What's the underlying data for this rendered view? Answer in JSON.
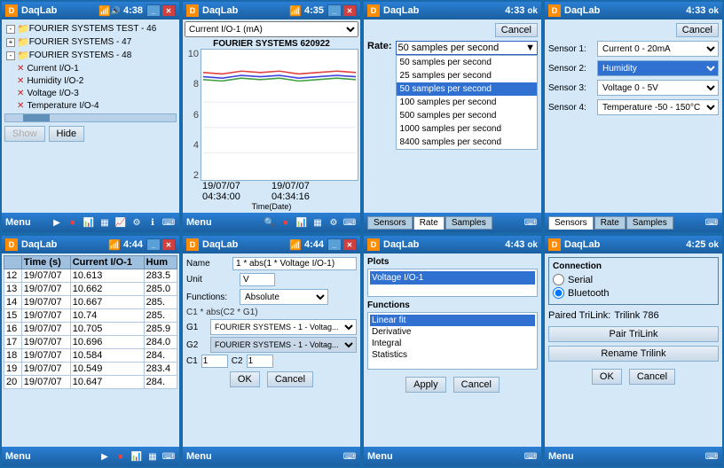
{
  "panels": {
    "p1": {
      "title": "DaqLab",
      "time": "4:38",
      "tree": {
        "items": [
          {
            "label": "FOURIER SYSTEMS TEST - 46",
            "level": 0,
            "type": "folder",
            "expanded": true
          },
          {
            "label": "FOURIER SYSTEMS - 47",
            "level": 0,
            "type": "folder",
            "expanded": false
          },
          {
            "label": "FOURIER SYSTEMS - 48",
            "level": 0,
            "type": "folder",
            "expanded": true
          },
          {
            "label": "Current I/O-1",
            "level": 1,
            "type": "sensor"
          },
          {
            "label": "Humidity I/O-2",
            "level": 1,
            "type": "sensor"
          },
          {
            "label": "Voltage I/O-3",
            "level": 1,
            "type": "sensor"
          },
          {
            "label": "Temperature I/O-4",
            "level": 1,
            "type": "sensor"
          }
        ]
      },
      "buttons": {
        "show": "Show",
        "hide": "Hide"
      },
      "menu": "Menu"
    },
    "p2": {
      "title": "DaqLab",
      "time": "4:35",
      "dropdown_value": "Current I/O-1 (mA)",
      "chart_title": "FOURIER SYSTEMS    620922",
      "x_label": "Time(Date)",
      "x_start": "19/07/07 04:34:00",
      "x_end": "19/07/07 04:34:16",
      "y_values": [
        "10",
        "8",
        "6",
        "4",
        "2"
      ],
      "menu": "Menu"
    },
    "p3": {
      "title": "DaqLab",
      "time": "4:33",
      "rate_label": "Rate:",
      "cancel_btn": "Cancel",
      "options": [
        {
          "label": "50 samples per second",
          "selected": false
        },
        {
          "label": "25 samples per second",
          "selected": false
        },
        {
          "label": "50 samples per second",
          "selected": true
        },
        {
          "label": "100 samples per second",
          "selected": false
        },
        {
          "label": "500 samples per second",
          "selected": false
        },
        {
          "label": "1000 samples per second",
          "selected": false
        },
        {
          "label": "8400 samples per second",
          "selected": false
        }
      ],
      "tabs": [
        "Sensors",
        "Rate",
        "Samples"
      ],
      "menu": "Menu"
    },
    "p4": {
      "title": "DaqLab",
      "time": "4:33",
      "cancel_btn": "Cancel",
      "sensors": [
        {
          "label": "Sensor 1:",
          "value": "Current 0 - 20mA",
          "highlighted": false
        },
        {
          "label": "Sensor 2:",
          "value": "Humidity",
          "highlighted": true
        },
        {
          "label": "Sensor 3:",
          "value": "Voltage 0 - 5V",
          "highlighted": false
        },
        {
          "label": "Sensor 4:",
          "value": "Temperature -50 - 150°C",
          "highlighted": false
        }
      ],
      "tabs": [
        "Sensors",
        "Rate",
        "Samples"
      ],
      "menu": "Menu"
    },
    "p5": {
      "title": "DaqLab",
      "time": "4:44",
      "columns": [
        "Time (s)",
        "Current I/O-1",
        "Hum"
      ],
      "rows": [
        {
          "n": "12",
          "time": "19/07/07",
          "curr": "10.613",
          "hum": "283.5"
        },
        {
          "n": "13",
          "time": "19/07/07",
          "curr": "10.662",
          "hum": "285.0"
        },
        {
          "n": "14",
          "time": "19/07/07",
          "curr": "10.667",
          "hum": "285."
        },
        {
          "n": "15",
          "time": "19/07/07",
          "curr": "10.74",
          "hum": "285."
        },
        {
          "n": "16",
          "time": "19/07/07",
          "curr": "10.705",
          "hum": "285.9"
        },
        {
          "n": "17",
          "time": "19/07/07",
          "curr": "10.696",
          "hum": "284.0"
        },
        {
          "n": "18",
          "time": "19/07/07",
          "curr": "10.584",
          "hum": "284."
        },
        {
          "n": "19",
          "time": "19/07/07",
          "curr": "10.549",
          "hum": "283.4"
        },
        {
          "n": "20",
          "time": "19/07/07",
          "curr": "10.647",
          "hum": "284."
        }
      ],
      "menu": "Menu"
    },
    "p6": {
      "title": "DaqLab",
      "time": "4:44",
      "name_label": "Name",
      "name_value": "1 * abs(1 * Voltage I/O-1)",
      "unit_label": "Unit",
      "unit_value": "V",
      "functions_label": "Functions:",
      "functions_value": "Absolute",
      "formula": "C1 * abs(C2 * G1)",
      "g1_label": "G1",
      "g1_value": "FOURIER SYSTEMS - 1 - Voltag...",
      "g2_label": "G2",
      "g2_value": "FOURIER SYSTEMS - 1 - Voltag...",
      "c1_label": "C1",
      "c1_value": "1",
      "c2_label": "C2",
      "c2_value": "1",
      "ok_btn": "OK",
      "cancel_btn": "Cancel",
      "menu": "Menu"
    },
    "p7": {
      "title": "DaqLab",
      "time": "4:43",
      "plots_label": "Plots",
      "plots_items": [
        {
          "label": "Voltage I/O-1",
          "selected": true
        }
      ],
      "functions_label": "Functions",
      "functions_items": [
        {
          "label": "Linear fit",
          "selected": true
        },
        {
          "label": "Derivative",
          "selected": false
        },
        {
          "label": "Integral",
          "selected": false
        },
        {
          "label": "Statistics",
          "selected": false
        }
      ],
      "apply_btn": "Apply",
      "cancel_btn": "Cancel",
      "menu": "Menu"
    },
    "p8": {
      "title": "DaqLab",
      "time": "4:25",
      "connection_title": "Connection",
      "serial_label": "Serial",
      "bluetooth_label": "Bluetooth",
      "bluetooth_selected": true,
      "paired_label": "Paired TriLink:",
      "paired_value": "Trilink 786",
      "pair_btn": "Pair TriLink",
      "rename_btn": "Rename Trilink",
      "ok_btn": "OK",
      "cancel_btn": "Cancel",
      "menu": "Menu"
    }
  }
}
